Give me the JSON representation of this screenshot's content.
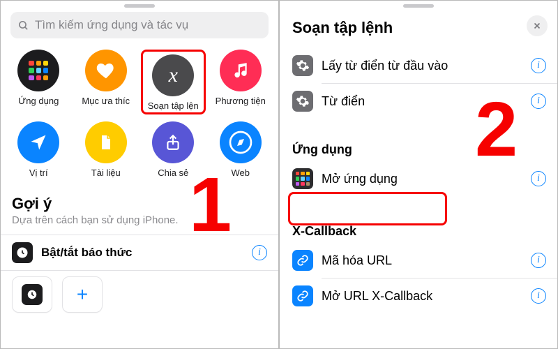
{
  "left": {
    "search_placeholder": "Tìm kiếm ứng dụng và tác vụ",
    "categories": [
      {
        "label": "Ứng dụng"
      },
      {
        "label": "Mục ưa thíc"
      },
      {
        "label": "Soạn tập lện"
      },
      {
        "label": "Phương tiện"
      },
      {
        "label": "Vị trí"
      },
      {
        "label": "Tài liệu"
      },
      {
        "label": "Chia sẻ"
      },
      {
        "label": "Web"
      }
    ],
    "suggestions_title": "Gợi ý",
    "suggestions_subtitle": "Dựa trên cách bạn sử dụng iPhone.",
    "suggestion_row": "Bật/tắt báo thức"
  },
  "right": {
    "title": "Soạn tập lệnh",
    "rows_top": [
      "Lấy từ điển từ đầu vào",
      "Từ điển"
    ],
    "section_apps": "Ứng dụng",
    "open_app": "Mở ứng dụng",
    "section_xcb": "X-Callback",
    "xcb_rows": [
      "Mã hóa URL",
      "Mở URL X-Callback"
    ]
  },
  "annotations": {
    "step1": "1",
    "step2": "2"
  }
}
